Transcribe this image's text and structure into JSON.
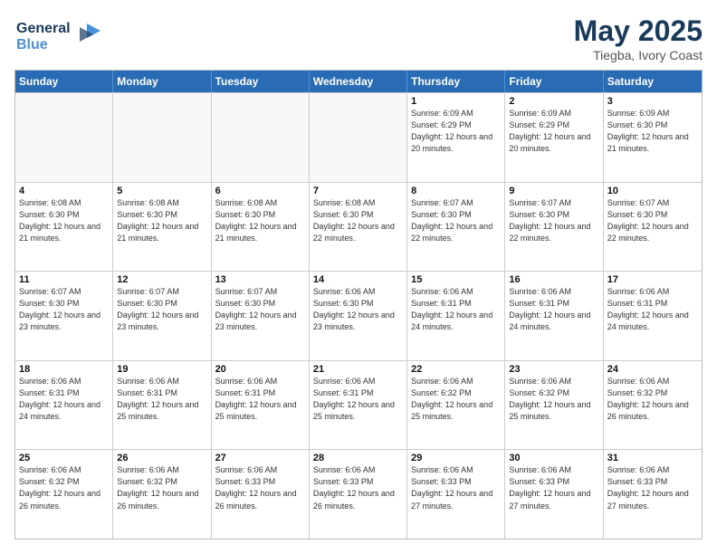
{
  "header": {
    "logo_line1": "General",
    "logo_line2": "Blue",
    "main_title": "May 2025",
    "subtitle": "Tiegba, Ivory Coast"
  },
  "calendar": {
    "days": [
      "Sunday",
      "Monday",
      "Tuesday",
      "Wednesday",
      "Thursday",
      "Friday",
      "Saturday"
    ],
    "weeks": [
      [
        {
          "date": "",
          "sunrise": "",
          "sunset": "",
          "daylight": "",
          "empty": true
        },
        {
          "date": "",
          "sunrise": "",
          "sunset": "",
          "daylight": "",
          "empty": true
        },
        {
          "date": "",
          "sunrise": "",
          "sunset": "",
          "daylight": "",
          "empty": true
        },
        {
          "date": "",
          "sunrise": "",
          "sunset": "",
          "daylight": "",
          "empty": true
        },
        {
          "date": "1",
          "sunrise": "Sunrise: 6:09 AM",
          "sunset": "Sunset: 6:29 PM",
          "daylight": "Daylight: 12 hours and 20 minutes."
        },
        {
          "date": "2",
          "sunrise": "Sunrise: 6:09 AM",
          "sunset": "Sunset: 6:29 PM",
          "daylight": "Daylight: 12 hours and 20 minutes."
        },
        {
          "date": "3",
          "sunrise": "Sunrise: 6:09 AM",
          "sunset": "Sunset: 6:30 PM",
          "daylight": "Daylight: 12 hours and 21 minutes."
        }
      ],
      [
        {
          "date": "4",
          "sunrise": "Sunrise: 6:08 AM",
          "sunset": "Sunset: 6:30 PM",
          "daylight": "Daylight: 12 hours and 21 minutes."
        },
        {
          "date": "5",
          "sunrise": "Sunrise: 6:08 AM",
          "sunset": "Sunset: 6:30 PM",
          "daylight": "Daylight: 12 hours and 21 minutes."
        },
        {
          "date": "6",
          "sunrise": "Sunrise: 6:08 AM",
          "sunset": "Sunset: 6:30 PM",
          "daylight": "Daylight: 12 hours and 21 minutes."
        },
        {
          "date": "7",
          "sunrise": "Sunrise: 6:08 AM",
          "sunset": "Sunset: 6:30 PM",
          "daylight": "Daylight: 12 hours and 22 minutes."
        },
        {
          "date": "8",
          "sunrise": "Sunrise: 6:07 AM",
          "sunset": "Sunset: 6:30 PM",
          "daylight": "Daylight: 12 hours and 22 minutes."
        },
        {
          "date": "9",
          "sunrise": "Sunrise: 6:07 AM",
          "sunset": "Sunset: 6:30 PM",
          "daylight": "Daylight: 12 hours and 22 minutes."
        },
        {
          "date": "10",
          "sunrise": "Sunrise: 6:07 AM",
          "sunset": "Sunset: 6:30 PM",
          "daylight": "Daylight: 12 hours and 22 minutes."
        }
      ],
      [
        {
          "date": "11",
          "sunrise": "Sunrise: 6:07 AM",
          "sunset": "Sunset: 6:30 PM",
          "daylight": "Daylight: 12 hours and 23 minutes."
        },
        {
          "date": "12",
          "sunrise": "Sunrise: 6:07 AM",
          "sunset": "Sunset: 6:30 PM",
          "daylight": "Daylight: 12 hours and 23 minutes."
        },
        {
          "date": "13",
          "sunrise": "Sunrise: 6:07 AM",
          "sunset": "Sunset: 6:30 PM",
          "daylight": "Daylight: 12 hours and 23 minutes."
        },
        {
          "date": "14",
          "sunrise": "Sunrise: 6:06 AM",
          "sunset": "Sunset: 6:30 PM",
          "daylight": "Daylight: 12 hours and 23 minutes."
        },
        {
          "date": "15",
          "sunrise": "Sunrise: 6:06 AM",
          "sunset": "Sunset: 6:31 PM",
          "daylight": "Daylight: 12 hours and 24 minutes."
        },
        {
          "date": "16",
          "sunrise": "Sunrise: 6:06 AM",
          "sunset": "Sunset: 6:31 PM",
          "daylight": "Daylight: 12 hours and 24 minutes."
        },
        {
          "date": "17",
          "sunrise": "Sunrise: 6:06 AM",
          "sunset": "Sunset: 6:31 PM",
          "daylight": "Daylight: 12 hours and 24 minutes."
        }
      ],
      [
        {
          "date": "18",
          "sunrise": "Sunrise: 6:06 AM",
          "sunset": "Sunset: 6:31 PM",
          "daylight": "Daylight: 12 hours and 24 minutes."
        },
        {
          "date": "19",
          "sunrise": "Sunrise: 6:06 AM",
          "sunset": "Sunset: 6:31 PM",
          "daylight": "Daylight: 12 hours and 25 minutes."
        },
        {
          "date": "20",
          "sunrise": "Sunrise: 6:06 AM",
          "sunset": "Sunset: 6:31 PM",
          "daylight": "Daylight: 12 hours and 25 minutes."
        },
        {
          "date": "21",
          "sunrise": "Sunrise: 6:06 AM",
          "sunset": "Sunset: 6:31 PM",
          "daylight": "Daylight: 12 hours and 25 minutes."
        },
        {
          "date": "22",
          "sunrise": "Sunrise: 6:06 AM",
          "sunset": "Sunset: 6:32 PM",
          "daylight": "Daylight: 12 hours and 25 minutes."
        },
        {
          "date": "23",
          "sunrise": "Sunrise: 6:06 AM",
          "sunset": "Sunset: 6:32 PM",
          "daylight": "Daylight: 12 hours and 25 minutes."
        },
        {
          "date": "24",
          "sunrise": "Sunrise: 6:06 AM",
          "sunset": "Sunset: 6:32 PM",
          "daylight": "Daylight: 12 hours and 26 minutes."
        }
      ],
      [
        {
          "date": "25",
          "sunrise": "Sunrise: 6:06 AM",
          "sunset": "Sunset: 6:32 PM",
          "daylight": "Daylight: 12 hours and 26 minutes."
        },
        {
          "date": "26",
          "sunrise": "Sunrise: 6:06 AM",
          "sunset": "Sunset: 6:32 PM",
          "daylight": "Daylight: 12 hours and 26 minutes."
        },
        {
          "date": "27",
          "sunrise": "Sunrise: 6:06 AM",
          "sunset": "Sunset: 6:33 PM",
          "daylight": "Daylight: 12 hours and 26 minutes."
        },
        {
          "date": "28",
          "sunrise": "Sunrise: 6:06 AM",
          "sunset": "Sunset: 6:33 PM",
          "daylight": "Daylight: 12 hours and 26 minutes."
        },
        {
          "date": "29",
          "sunrise": "Sunrise: 6:06 AM",
          "sunset": "Sunset: 6:33 PM",
          "daylight": "Daylight: 12 hours and 27 minutes."
        },
        {
          "date": "30",
          "sunrise": "Sunrise: 6:06 AM",
          "sunset": "Sunset: 6:33 PM",
          "daylight": "Daylight: 12 hours and 27 minutes."
        },
        {
          "date": "31",
          "sunrise": "Sunrise: 6:06 AM",
          "sunset": "Sunset: 6:33 PM",
          "daylight": "Daylight: 12 hours and 27 minutes."
        }
      ]
    ]
  }
}
